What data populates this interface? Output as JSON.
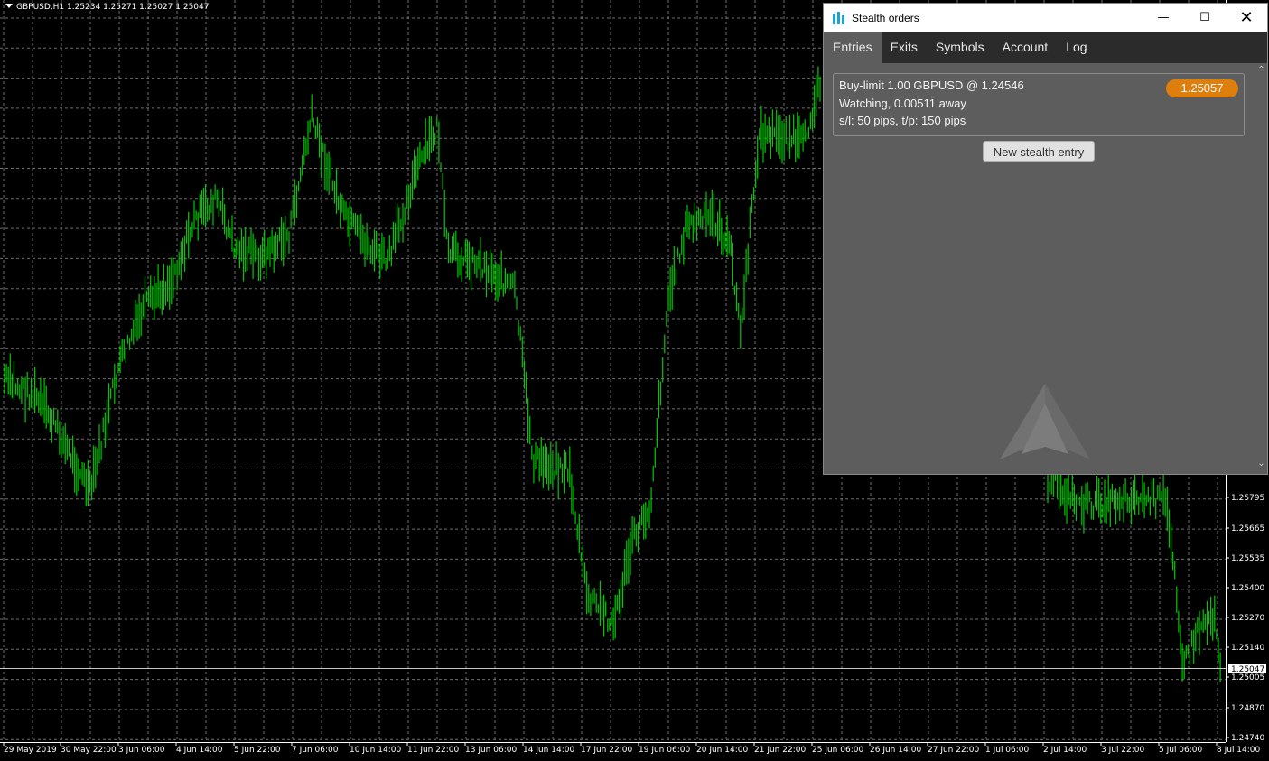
{
  "chart": {
    "symbol_info": "GBPUSD,H1  1.25234 1.25271 1.25027 1.25047",
    "line_color": "#00c800",
    "grid_color": "#8a8a8a",
    "price_labels": [
      "1.25795",
      "1.25665",
      "1.25535",
      "1.25400",
      "1.25270",
      "1.25140",
      "1.25005",
      "1.24870",
      "1.24740"
    ],
    "current_price": "1.25047",
    "time_labels": [
      "29 May 2019",
      "30 May 22:00",
      "3 Jun 06:00",
      "4 Jun 14:00",
      "5 Jun 22:00",
      "7 Jun 06:00",
      "10 Jun 14:00",
      "11 Jun 22:00",
      "13 Jun 06:00",
      "14 Jun 14:00",
      "17 Jun 22:00",
      "19 Jun 06:00",
      "20 Jun 14:00",
      "21 Jun 22:00",
      "25 Jun 06:00",
      "26 Jun 14:00",
      "27 Jun 22:00",
      "1 Jul 06:00",
      "2 Jul 14:00",
      "3 Jul 22:00",
      "5 Jul 06:00",
      "8 Jul 14:00"
    ]
  },
  "window": {
    "title": "Stealth orders",
    "tabs": [
      "Entries",
      "Exits",
      "Symbols",
      "Account",
      "Log"
    ],
    "active_tab": "Entries",
    "accent_color": "#dd7e0d",
    "order": {
      "line1": "Buy-limit 1.00 GBPUSD @ 1.24546",
      "line2": "Watching, 0.00511 away",
      "line3": "s/l: 50 pips, t/p: 150 pips",
      "price": "1.25057"
    },
    "new_entry_label": "New stealth entry"
  }
}
